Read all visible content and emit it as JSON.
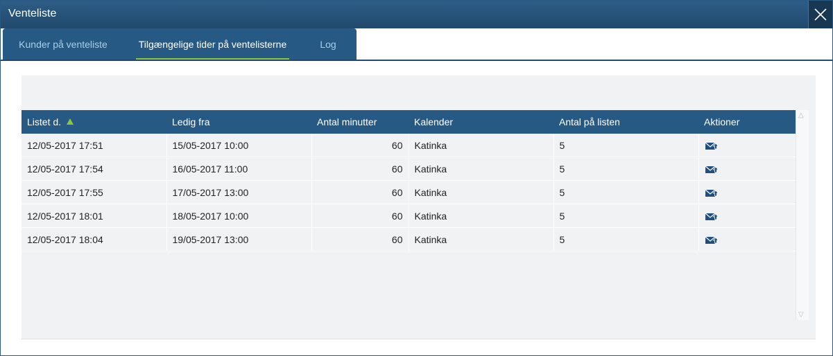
{
  "window": {
    "title": "Venteliste"
  },
  "tabs": [
    {
      "label": "Kunder på venteliste"
    },
    {
      "label": "Tilgængelige tider på ventelisterne"
    },
    {
      "label": "Log"
    }
  ],
  "table": {
    "headers": [
      "Listet d.",
      "Ledig fra",
      "Antal minutter",
      "Kalender",
      "Antal på listen",
      "Aktioner"
    ],
    "rows": [
      [
        "12/05-2017 17:51",
        "15/05-2017 10:00",
        "60",
        "Katinka",
        "5"
      ],
      [
        "12/05-2017 17:54",
        "16/05-2017 11:00",
        "60",
        "Katinka",
        "5"
      ],
      [
        "12/05-2017 17:55",
        "17/05-2017 13:00",
        "60",
        "Katinka",
        "5"
      ],
      [
        "12/05-2017 18:01",
        "18/05-2017 10:00",
        "60",
        "Katinka",
        "5"
      ],
      [
        "12/05-2017 18:04",
        "19/05-2017 13:00",
        "60",
        "Katinka",
        "5"
      ]
    ]
  },
  "icons": {
    "close": "close-icon",
    "sort": "sort-ascending-icon",
    "action": "mail-send-icon"
  },
  "colors": {
    "titlebar": "#22496d",
    "tab_accent": "#8cc63e",
    "header": "#265a85"
  }
}
